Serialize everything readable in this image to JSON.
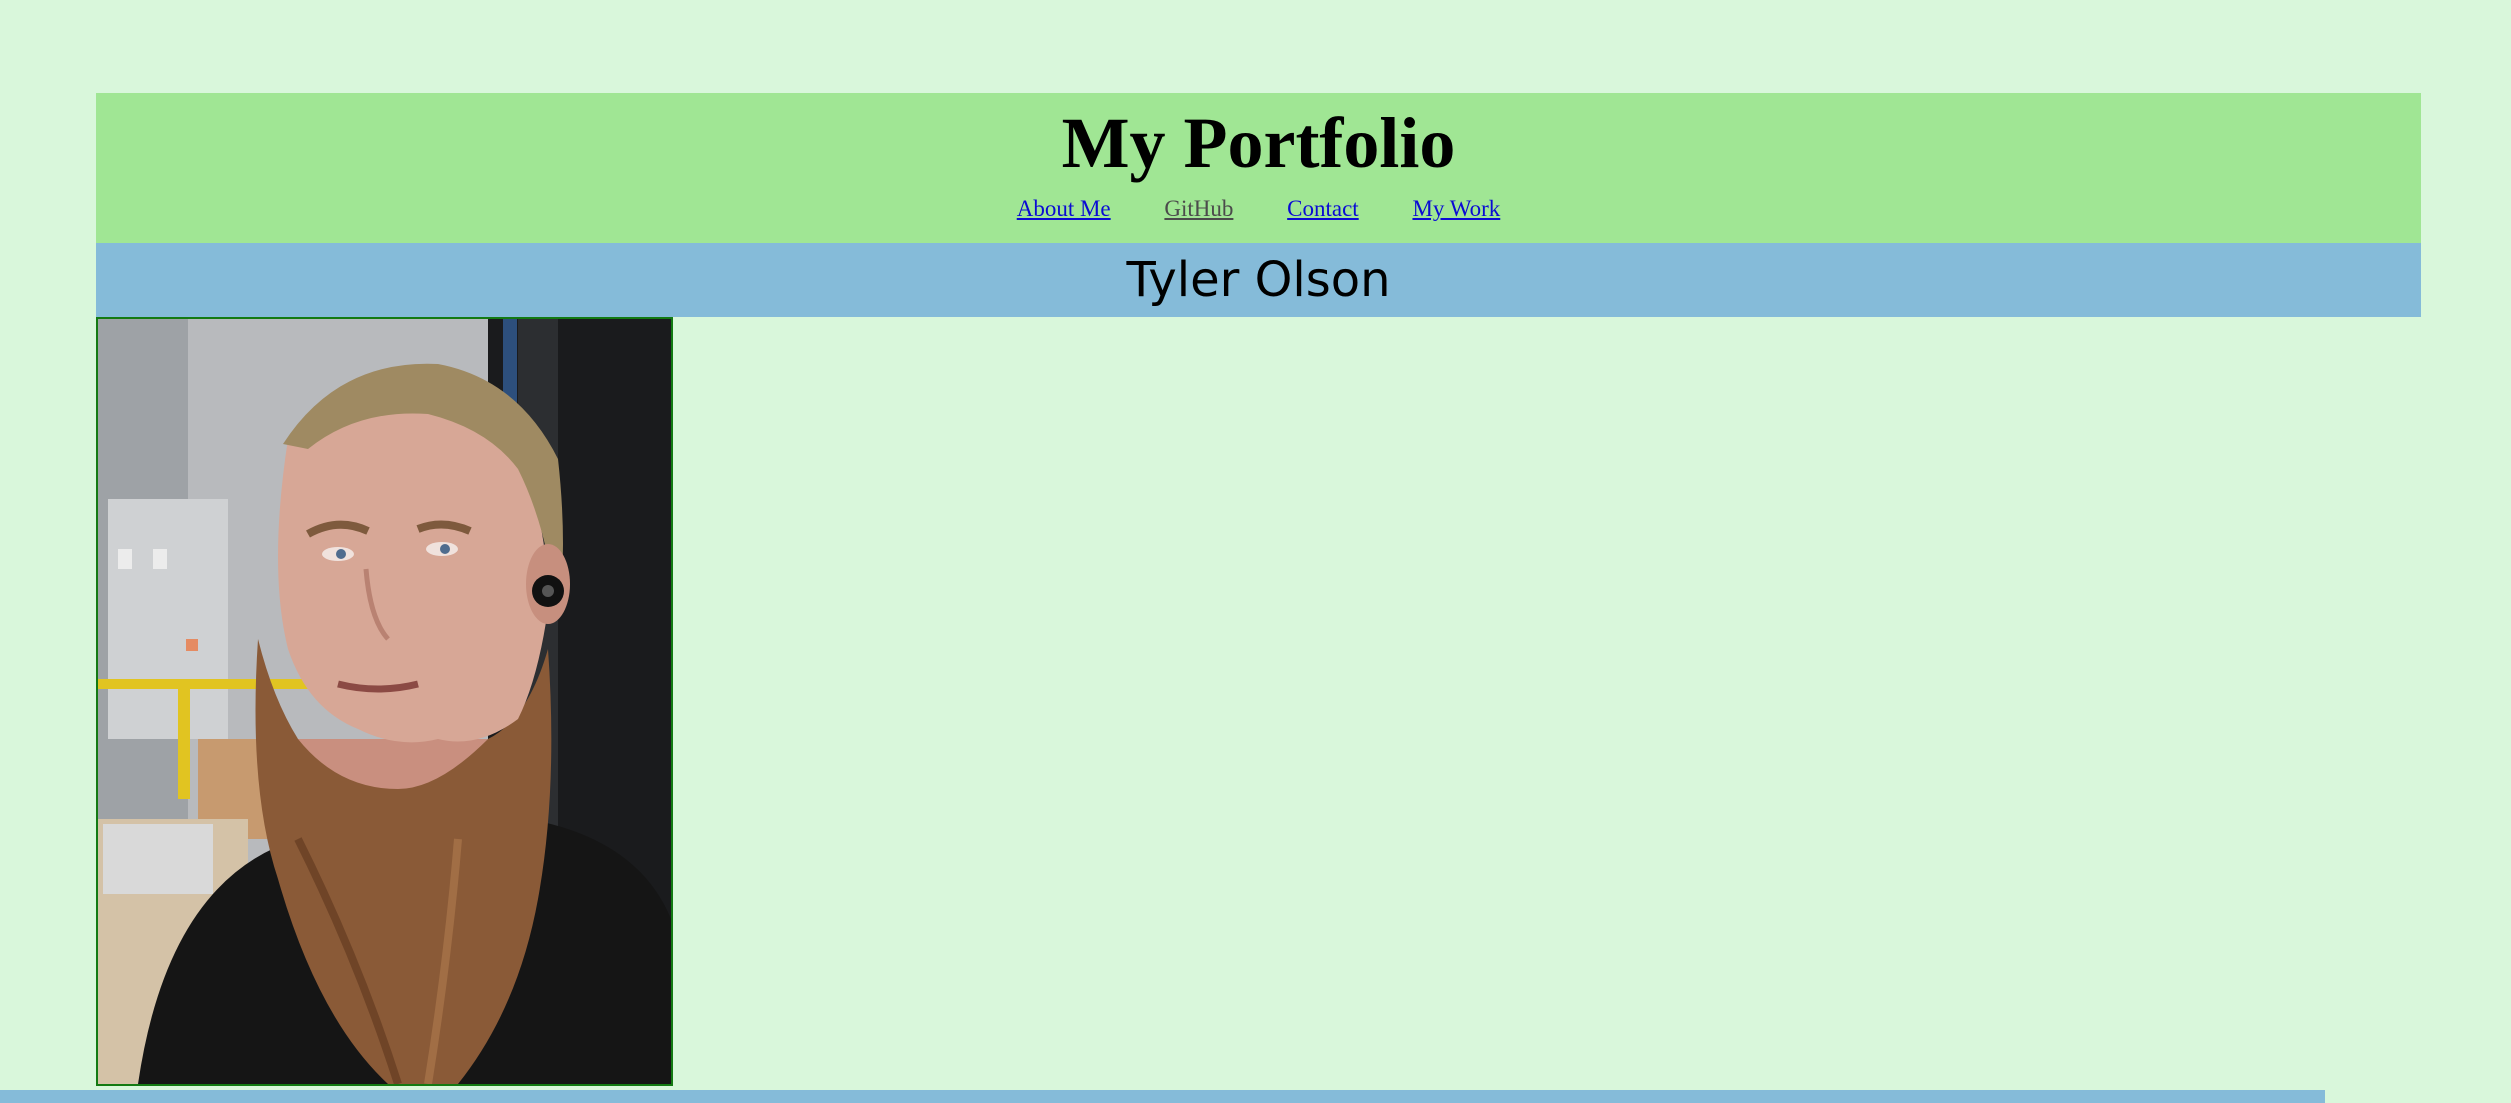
{
  "header": {
    "title": "My Portfolio",
    "nav": [
      {
        "label": "About Me",
        "state": "link"
      },
      {
        "label": "GitHub",
        "state": "visited"
      },
      {
        "label": "Contact",
        "state": "link"
      },
      {
        "label": "My Work",
        "state": "link"
      }
    ]
  },
  "profile": {
    "name": "Tyler Olson",
    "photo_icon": "portrait-photo"
  },
  "colors": {
    "background": "#d9f7db",
    "header": "#a0e694",
    "name_bar": "#85bbd9",
    "link": "#0a0ad4",
    "visited_link": "#4b4b4b",
    "photo_border": "#137a13"
  }
}
